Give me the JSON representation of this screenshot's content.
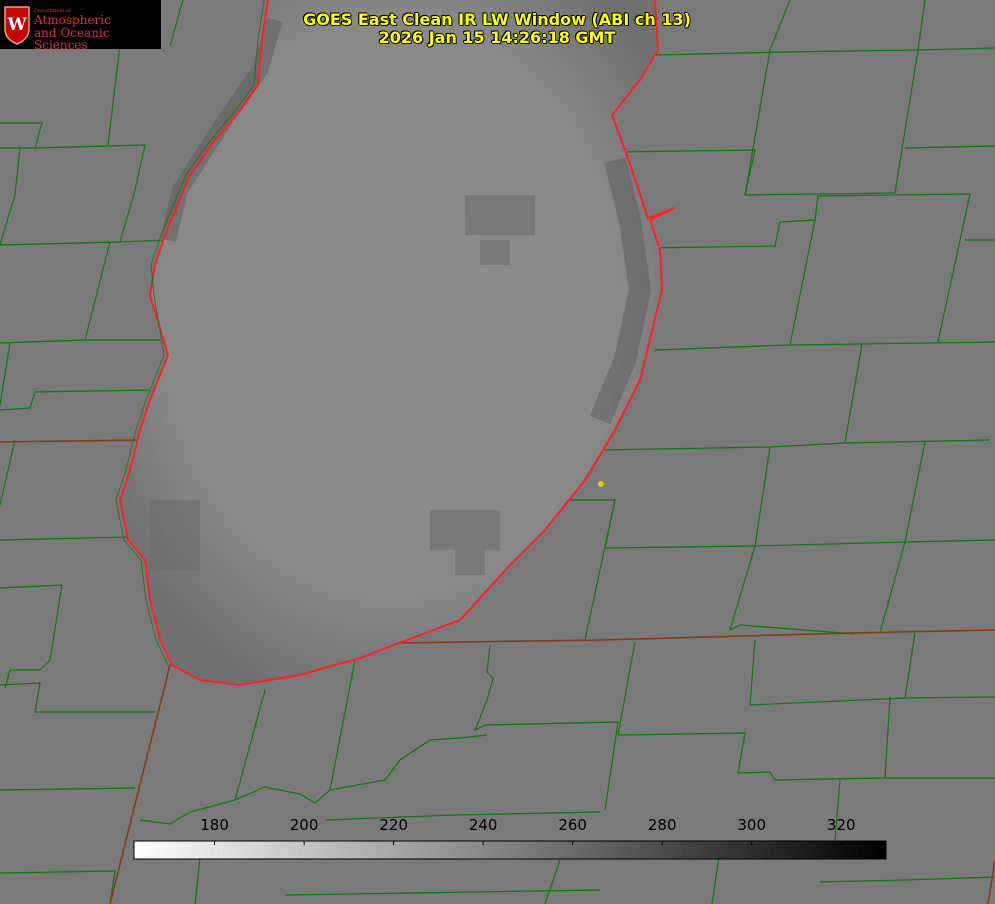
{
  "logo": {
    "department": "Department of",
    "line1": "Atmospheric",
    "line2": "and Oceanic Sciences",
    "letter": "W",
    "color": "#d8323a"
  },
  "title": {
    "line1": "GOES East Clean IR LW Window (ABI ch 13)",
    "line2": "2026 Jan 15 14:26:18 GMT",
    "color": "#ffff00"
  },
  "colorbar": {
    "ticks": [
      "180",
      "200",
      "220",
      "240",
      "260",
      "280",
      "300",
      "320"
    ],
    "min": 162,
    "max": 330,
    "start_color": "#ffffff",
    "end_color": "#000000"
  },
  "map_colors": {
    "background": "#7a7a7a",
    "lake_surface": "#888888",
    "boundary_lines": "#0a7a0a",
    "coastline": "#ff2020",
    "state_line": "#8a3a10",
    "marker": "#e0d000"
  }
}
